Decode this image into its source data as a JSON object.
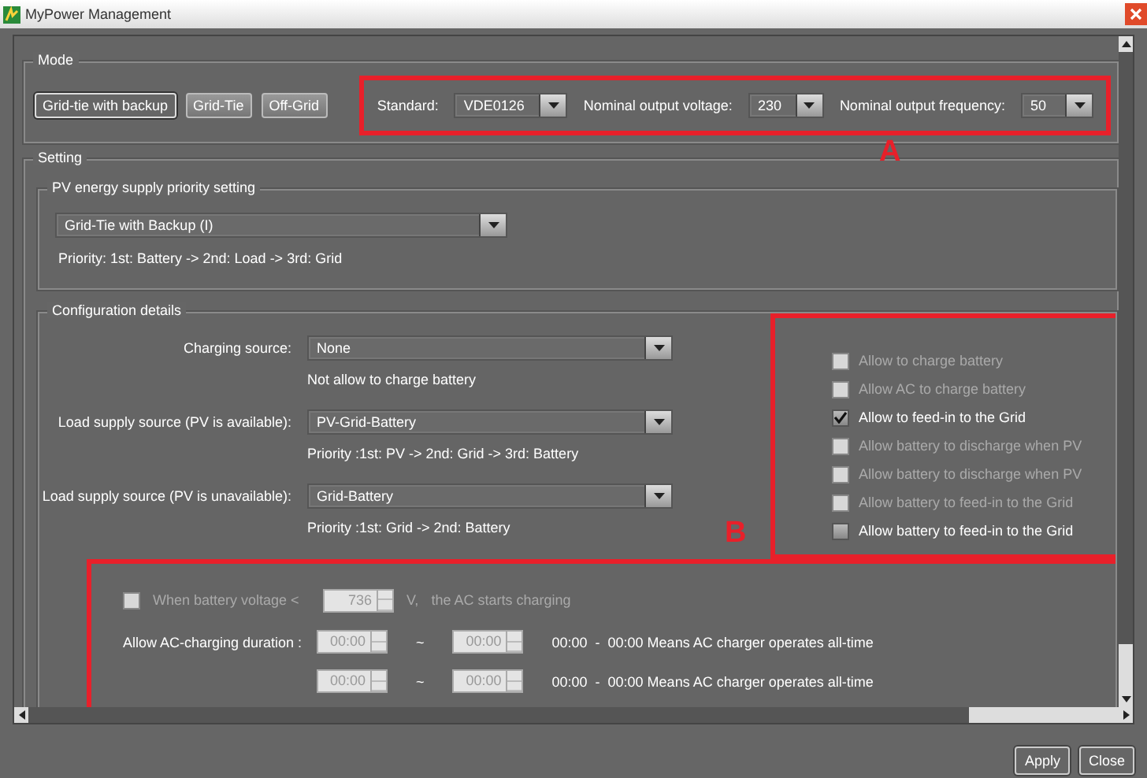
{
  "window": {
    "title": "MyPower Management"
  },
  "mode": {
    "label": "Mode",
    "buttons": [
      {
        "label": "Grid-tie with backup",
        "selected": true
      },
      {
        "label": "Grid-Tie",
        "selected": false
      },
      {
        "label": "Off-Grid",
        "selected": false
      }
    ],
    "selects": [
      {
        "label": "Standard:",
        "value": "VDE0126"
      },
      {
        "label": "Nominal output voltage:",
        "value": "230"
      },
      {
        "label": "Nominal output frequency:",
        "value": "50"
      }
    ]
  },
  "setting": {
    "label": "Setting",
    "pv_priority": {
      "label": "PV energy supply priority setting",
      "value": "Grid-Tie with Backup (I)",
      "note": "Priority: 1st: Battery -> 2nd: Load -> 3rd: Grid"
    },
    "configuration": {
      "label": "Configuration details",
      "rows": [
        {
          "label": "Charging source:",
          "value": "None",
          "note": "Not allow to charge battery"
        },
        {
          "label": "Load supply source (PV is available):",
          "value": "PV-Grid-Battery",
          "note": "Priority :1st: PV -> 2nd: Grid -> 3rd: Battery"
        },
        {
          "label": "Load supply source (PV is unavailable):",
          "value": "Grid-Battery",
          "note": "Priority :1st: Grid -> 2nd: Battery"
        }
      ],
      "options": [
        {
          "label": "Allow to charge battery",
          "checked": false,
          "disabled": true
        },
        {
          "label": "Allow AC to charge battery",
          "checked": false,
          "disabled": true
        },
        {
          "label": "Allow to feed-in to the Grid",
          "checked": true,
          "disabled": false
        },
        {
          "label": "Allow battery to discharge when PV",
          "checked": false,
          "disabled": true
        },
        {
          "label": "Allow battery to discharge when PV",
          "checked": false,
          "disabled": true
        },
        {
          "label": "Allow battery to feed-in to the Grid",
          "checked": false,
          "disabled": true
        },
        {
          "label": "Allow battery to feed-in to the Grid",
          "checked": false,
          "disabled": false
        }
      ]
    },
    "battery_voltage": {
      "label": "When battery voltage <",
      "checked": false,
      "disabled": true,
      "value": "736",
      "unit": "V,",
      "suffix": "the AC starts charging"
    },
    "ac_charging": {
      "label": "Allow AC-charging duration :",
      "rows": [
        {
          "start": "00:00",
          "separator": "~",
          "end": "00:00",
          "note": "00:00  -  00:00 Means AC charger operates all-time"
        },
        {
          "start": "00:00",
          "separator": "~",
          "end": "00:00",
          "note": "00:00  -  00:00 Means AC charger operates all-time"
        }
      ]
    }
  },
  "annotations": [
    {
      "label": "A"
    },
    {
      "label": "B"
    }
  ],
  "buttons": [
    "Apply",
    "Close"
  ]
}
